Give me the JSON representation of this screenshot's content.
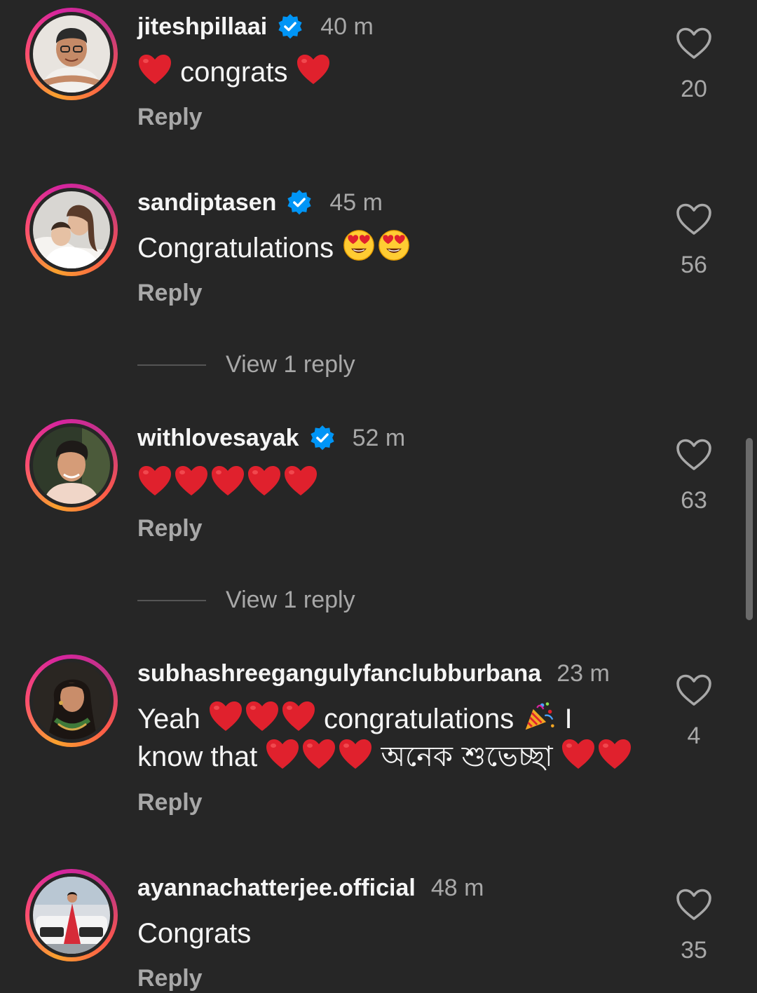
{
  "comments": [
    {
      "username": "jiteshpillaai",
      "verified": true,
      "time": "40 m",
      "text_parts": [
        "congrats"
      ],
      "reply_label": "Reply",
      "likes": "20"
    },
    {
      "username": "sandiptasen",
      "verified": true,
      "time": "45 m",
      "text_parts": [
        "Congratulations"
      ],
      "reply_label": "Reply",
      "likes": "56",
      "view_replies": "View 1 reply"
    },
    {
      "username": "withlovesayak",
      "verified": true,
      "time": "52 m",
      "text_parts": [],
      "reply_label": "Reply",
      "likes": "63",
      "view_replies": "View 1 reply"
    },
    {
      "username": "subhashreegangulyfanclubburbana",
      "verified": false,
      "time": "23 m",
      "text_parts": [
        "Yeah",
        "congratulations",
        "I",
        "know that",
        "অনেক শুভেচ্ছা"
      ],
      "reply_label": "Reply",
      "likes": "4"
    },
    {
      "username": "ayannachatterjee.official",
      "verified": false,
      "time": "48 m",
      "text_parts": [
        "Congrats"
      ],
      "reply_label": "Reply",
      "likes": "35"
    }
  ],
  "icons": {
    "like": "heart-outline-icon",
    "verified": "verified-badge-icon",
    "heart_emoji": "red-heart-emoji",
    "heart_eyes_emoji": "heart-eyes-emoji",
    "party_emoji": "party-popper-emoji"
  },
  "colors": {
    "background": "#262626",
    "verified": "#0095f6",
    "muted": "#a8a8a8",
    "heart": "#e0212d"
  }
}
